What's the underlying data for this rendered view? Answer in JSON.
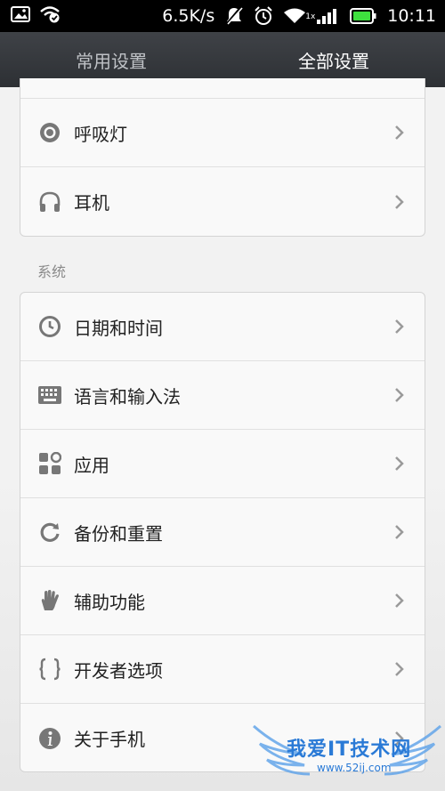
{
  "status_bar": {
    "speed": "6.5K/s",
    "time": "10:11",
    "signal_label": "1x"
  },
  "tabs": [
    {
      "label": "常用设置",
      "active": false
    },
    {
      "label": "全部设置",
      "active": true
    }
  ],
  "card_top": {
    "items": [
      {
        "label": "呼吸灯",
        "icon": "breathing-light-icon"
      },
      {
        "label": "耳机",
        "icon": "headphones-icon"
      }
    ]
  },
  "system_section": {
    "title": "系统",
    "items": [
      {
        "label": "日期和时间",
        "icon": "clock-icon"
      },
      {
        "label": "语言和输入法",
        "icon": "keyboard-icon"
      },
      {
        "label": "应用",
        "icon": "apps-icon"
      },
      {
        "label": "备份和重置",
        "icon": "backup-icon"
      },
      {
        "label": "辅助功能",
        "icon": "hand-icon"
      },
      {
        "label": "开发者选项",
        "icon": "braces-icon"
      },
      {
        "label": "关于手机",
        "icon": "info-icon"
      }
    ]
  },
  "watermark": {
    "text": "我爱IT技术网",
    "url": "www.52ij.com"
  },
  "colors": {
    "tab_bar": "#34373b",
    "icon_gray": "#777777",
    "battery_green": "#3ee03e"
  }
}
